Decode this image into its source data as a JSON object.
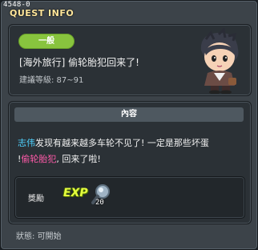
{
  "window": {
    "quest_id": "4548-0",
    "title": "QUEST INFO"
  },
  "summary": {
    "category": "一般",
    "quest_name": "[海外旅行] 偷轮胎犯回来了!",
    "level_requirement": "建議等級: 87~91",
    "portrait_icon": "npc-portrait-icon"
  },
  "content": {
    "header": "內容",
    "description": {
      "part1_name": "志伟",
      "part2": "发现有越来越多车轮不见了! 一定是那些坏蛋",
      "part3": "!",
      "part4_name": "偷轮胎犯",
      "part5": ", 回来了啦!"
    },
    "reward": {
      "label": "獎勵",
      "exp_icon_text": "EXP",
      "value": "20"
    }
  },
  "status": {
    "text": "狀態: 可開始"
  },
  "colors": {
    "category_pill": "#88c43e",
    "title_text": "#ffe69a",
    "highlight_blue": "#4fd2ff",
    "highlight_pink": "#ff5aa9"
  }
}
